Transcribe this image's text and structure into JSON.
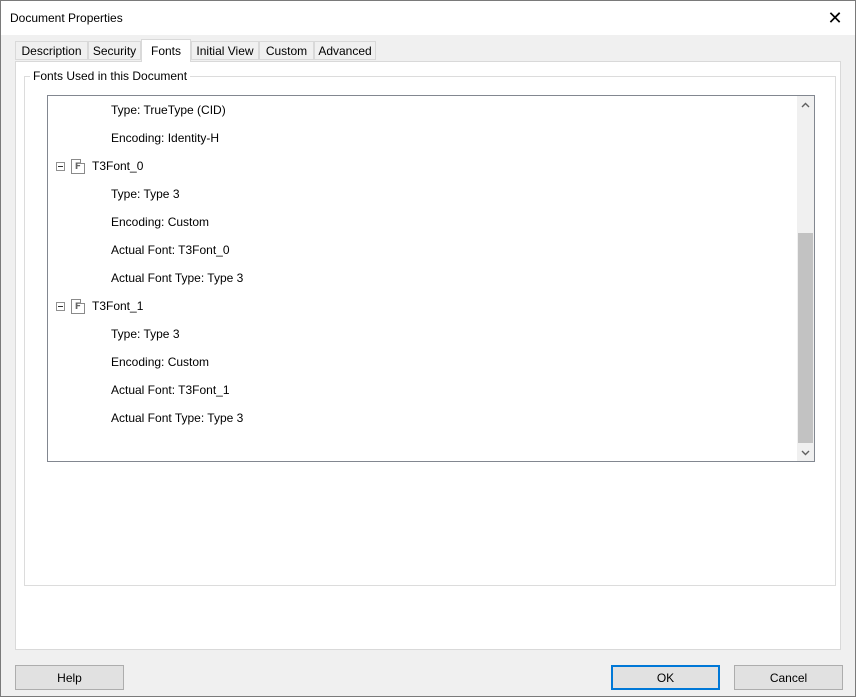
{
  "window": {
    "title": "Document Properties"
  },
  "tabs": [
    {
      "label": "Description"
    },
    {
      "label": "Security"
    },
    {
      "label": "Fonts"
    },
    {
      "label": "Initial View"
    },
    {
      "label": "Custom"
    },
    {
      "label": "Advanced"
    }
  ],
  "active_tab": "Fonts",
  "group": {
    "label": "Fonts Used in this Document"
  },
  "tree": {
    "rows": [
      {
        "text": "Type: TrueType (CID)"
      },
      {
        "text": "Encoding: Identity-H"
      },
      {
        "text": "T3Font_0"
      },
      {
        "text": "Type: Type 3"
      },
      {
        "text": "Encoding: Custom"
      },
      {
        "text": "Actual Font: T3Font_0"
      },
      {
        "text": "Actual Font Type: Type 3"
      },
      {
        "text": "T3Font_1"
      },
      {
        "text": "Type: Type 3"
      },
      {
        "text": "Encoding: Custom"
      },
      {
        "text": "Actual Font: T3Font_1"
      },
      {
        "text": "Actual Font Type: Type 3"
      }
    ]
  },
  "buttons": {
    "help": "Help",
    "ok": "OK",
    "cancel": "Cancel"
  },
  "icons": {
    "close": "close-icon",
    "font": "font-file-icon",
    "collapse": "collapse-icon",
    "scroll_up": "chevron-up-icon",
    "scroll_down": "chevron-down-icon"
  },
  "colors": {
    "accent": "#0078d7"
  }
}
